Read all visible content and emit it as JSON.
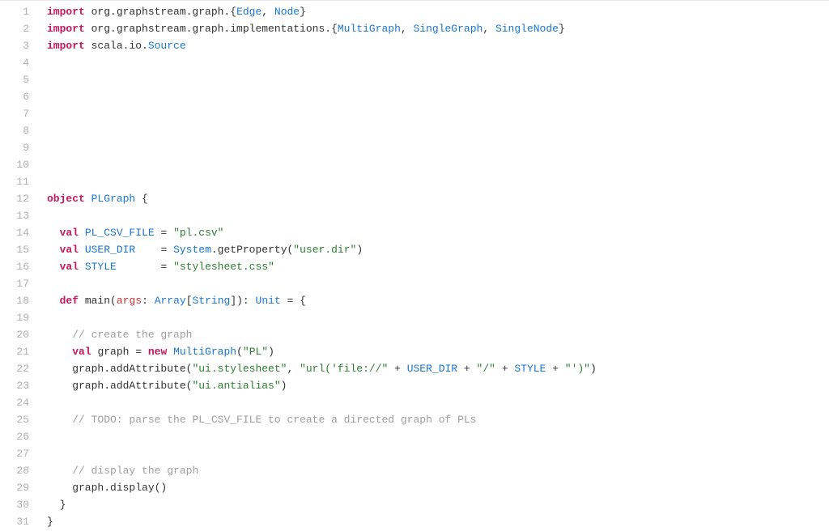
{
  "lines": [
    {
      "n": 1,
      "tokens": [
        {
          "t": "import ",
          "c": "kw"
        },
        {
          "t": "org.graphstream.graph.",
          "c": "pkg"
        },
        {
          "t": "{",
          "c": "typebr"
        },
        {
          "t": "Edge",
          "c": "cls"
        },
        {
          "t": ", ",
          "c": "op"
        },
        {
          "t": "Node",
          "c": "cls"
        },
        {
          "t": "}",
          "c": "typebr"
        }
      ]
    },
    {
      "n": 2,
      "tokens": [
        {
          "t": "import ",
          "c": "kw"
        },
        {
          "t": "org.graphstream.graph.implementations.",
          "c": "pkg"
        },
        {
          "t": "{",
          "c": "typebr"
        },
        {
          "t": "MultiGraph",
          "c": "cls"
        },
        {
          "t": ", ",
          "c": "op"
        },
        {
          "t": "SingleGraph",
          "c": "cls"
        },
        {
          "t": ", ",
          "c": "op"
        },
        {
          "t": "SingleNode",
          "c": "cls"
        },
        {
          "t": "}",
          "c": "typebr"
        }
      ]
    },
    {
      "n": 3,
      "tokens": [
        {
          "t": "import ",
          "c": "kw"
        },
        {
          "t": "scala.io.",
          "c": "pkg"
        },
        {
          "t": "Source",
          "c": "cls"
        }
      ]
    },
    {
      "n": 4,
      "tokens": []
    },
    {
      "n": 5,
      "tokens": []
    },
    {
      "n": 6,
      "tokens": []
    },
    {
      "n": 7,
      "tokens": []
    },
    {
      "n": 8,
      "tokens": []
    },
    {
      "n": 9,
      "tokens": []
    },
    {
      "n": 10,
      "tokens": []
    },
    {
      "n": 11,
      "tokens": []
    },
    {
      "n": 12,
      "tokens": [
        {
          "t": "object ",
          "c": "kw"
        },
        {
          "t": "PLGraph",
          "c": "cls"
        },
        {
          "t": " {",
          "c": "op"
        }
      ]
    },
    {
      "n": 13,
      "tokens": []
    },
    {
      "n": 14,
      "tokens": [
        {
          "t": "  ",
          "c": "op"
        },
        {
          "t": "val ",
          "c": "kw"
        },
        {
          "t": "PL_CSV_FILE",
          "c": "cls"
        },
        {
          "t": " = ",
          "c": "op"
        },
        {
          "t": "\"pl.csv\"",
          "c": "str"
        }
      ]
    },
    {
      "n": 15,
      "tokens": [
        {
          "t": "  ",
          "c": "op"
        },
        {
          "t": "val ",
          "c": "kw"
        },
        {
          "t": "USER_DIR",
          "c": "cls"
        },
        {
          "t": "    = ",
          "c": "op"
        },
        {
          "t": "System",
          "c": "cls"
        },
        {
          "t": ".getProperty(",
          "c": "op"
        },
        {
          "t": "\"user.dir\"",
          "c": "str"
        },
        {
          "t": ")",
          "c": "op"
        }
      ]
    },
    {
      "n": 16,
      "tokens": [
        {
          "t": "  ",
          "c": "op"
        },
        {
          "t": "val ",
          "c": "kw"
        },
        {
          "t": "STYLE",
          "c": "cls"
        },
        {
          "t": "       = ",
          "c": "op"
        },
        {
          "t": "\"stylesheet.css\"",
          "c": "str"
        }
      ]
    },
    {
      "n": 17,
      "tokens": []
    },
    {
      "n": 18,
      "tokens": [
        {
          "t": "  ",
          "c": "op"
        },
        {
          "t": "def ",
          "c": "kw"
        },
        {
          "t": "main",
          "c": "fn"
        },
        {
          "t": "(",
          "c": "op"
        },
        {
          "t": "args",
          "c": "prm"
        },
        {
          "t": ": ",
          "c": "op"
        },
        {
          "t": "Array",
          "c": "cls"
        },
        {
          "t": "[",
          "c": "op"
        },
        {
          "t": "String",
          "c": "cls"
        },
        {
          "t": "]): ",
          "c": "op"
        },
        {
          "t": "Unit",
          "c": "cls"
        },
        {
          "t": " = {",
          "c": "op"
        }
      ]
    },
    {
      "n": 19,
      "tokens": []
    },
    {
      "n": 20,
      "tokens": [
        {
          "t": "    ",
          "c": "op"
        },
        {
          "t": "// create the graph",
          "c": "cmt"
        }
      ]
    },
    {
      "n": 21,
      "tokens": [
        {
          "t": "    ",
          "c": "op"
        },
        {
          "t": "val ",
          "c": "kw"
        },
        {
          "t": "graph",
          "c": "id"
        },
        {
          "t": " = ",
          "c": "op"
        },
        {
          "t": "new ",
          "c": "kw"
        },
        {
          "t": "MultiGraph",
          "c": "cls"
        },
        {
          "t": "(",
          "c": "op"
        },
        {
          "t": "\"PL\"",
          "c": "str"
        },
        {
          "t": ")",
          "c": "op"
        }
      ]
    },
    {
      "n": 22,
      "tokens": [
        {
          "t": "    graph.addAttribute(",
          "c": "op"
        },
        {
          "t": "\"ui.stylesheet\"",
          "c": "str"
        },
        {
          "t": ", ",
          "c": "op"
        },
        {
          "t": "\"url('file://\"",
          "c": "str"
        },
        {
          "t": " + ",
          "c": "op"
        },
        {
          "t": "USER_DIR",
          "c": "cls"
        },
        {
          "t": " + ",
          "c": "op"
        },
        {
          "t": "\"/\"",
          "c": "str"
        },
        {
          "t": " + ",
          "c": "op"
        },
        {
          "t": "STYLE",
          "c": "cls"
        },
        {
          "t": " + ",
          "c": "op"
        },
        {
          "t": "\"')\"",
          "c": "str"
        },
        {
          "t": ")",
          "c": "op"
        }
      ]
    },
    {
      "n": 23,
      "tokens": [
        {
          "t": "    graph.addAttribute(",
          "c": "op"
        },
        {
          "t": "\"ui.antialias\"",
          "c": "str"
        },
        {
          "t": ")",
          "c": "op"
        }
      ]
    },
    {
      "n": 24,
      "tokens": []
    },
    {
      "n": 25,
      "tokens": [
        {
          "t": "    ",
          "c": "op"
        },
        {
          "t": "// TODO: parse the PL_CSV_FILE to create a directed graph of PLs",
          "c": "cmt"
        }
      ]
    },
    {
      "n": 26,
      "tokens": []
    },
    {
      "n": 27,
      "tokens": []
    },
    {
      "n": 28,
      "tokens": [
        {
          "t": "    ",
          "c": "op"
        },
        {
          "t": "// display the graph",
          "c": "cmt"
        }
      ]
    },
    {
      "n": 29,
      "tokens": [
        {
          "t": "    graph.display()",
          "c": "op"
        }
      ]
    },
    {
      "n": 30,
      "tokens": [
        {
          "t": "  }",
          "c": "op"
        }
      ]
    },
    {
      "n": 31,
      "tokens": [
        {
          "t": "}",
          "c": "op"
        }
      ]
    }
  ]
}
